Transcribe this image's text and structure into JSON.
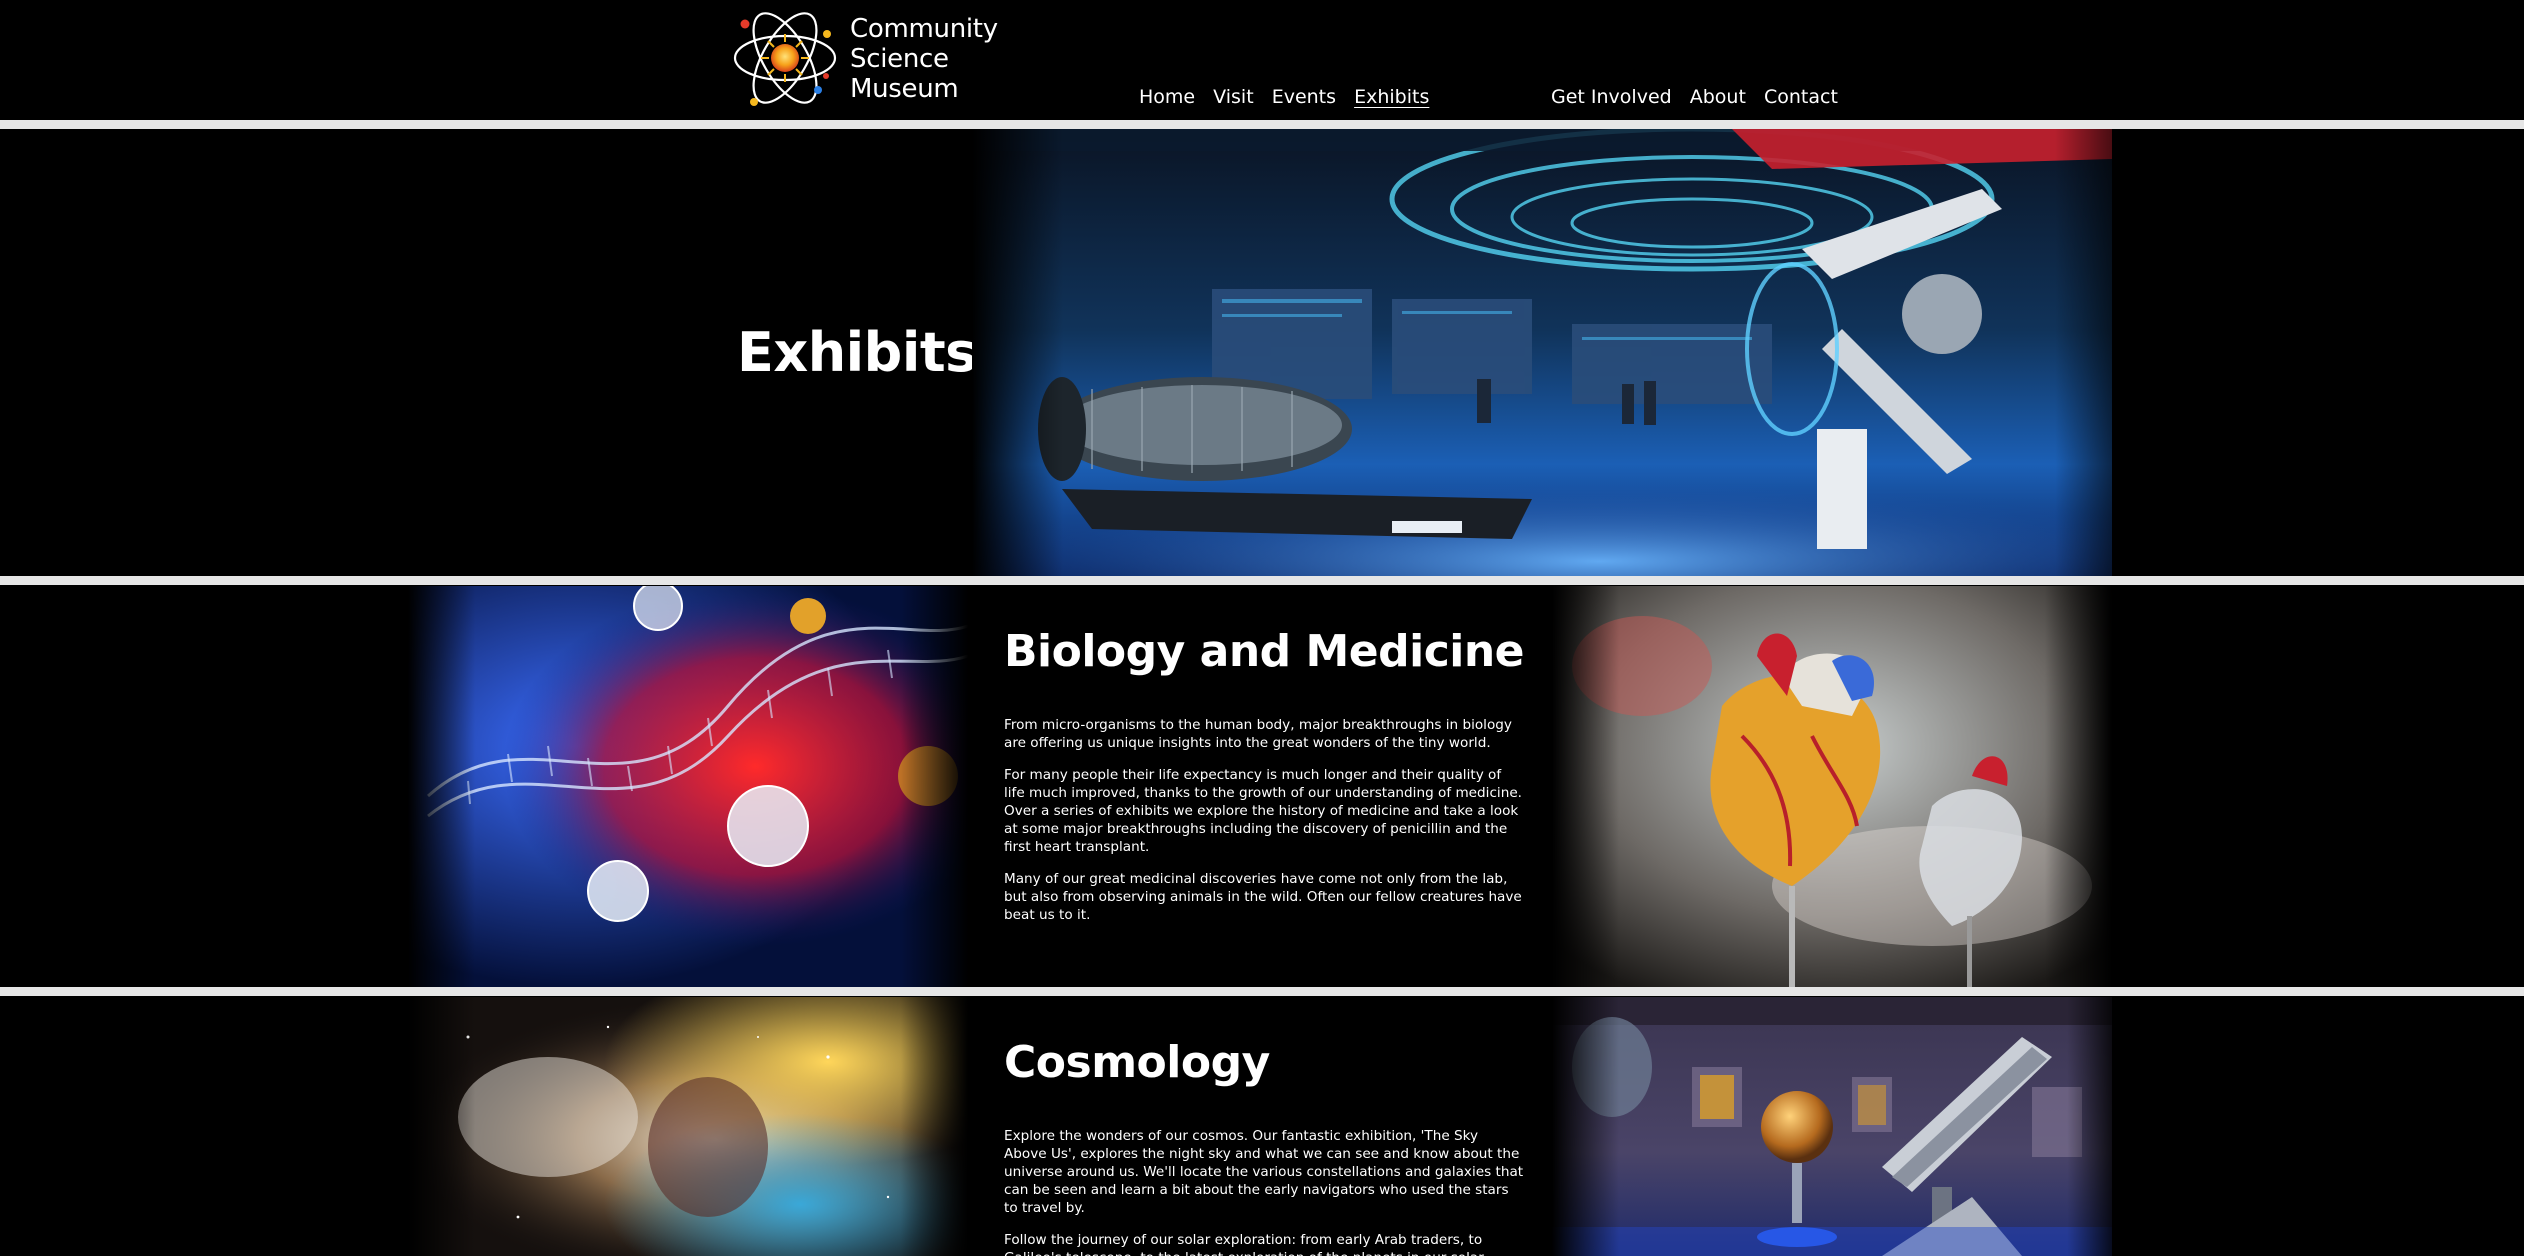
{
  "site": {
    "name_lines": [
      "Community",
      "Science",
      "Museum"
    ]
  },
  "nav": {
    "left": [
      {
        "label": "Home",
        "active": false
      },
      {
        "label": "Visit",
        "active": false
      },
      {
        "label": "Events",
        "active": false
      },
      {
        "label": "Exhibits",
        "active": true
      }
    ],
    "right": [
      {
        "label": "Get Involved"
      },
      {
        "label": "About"
      },
      {
        "label": "Contact"
      }
    ]
  },
  "hero": {
    "title": "Exhibits",
    "image": "exhibition-hall-photo"
  },
  "sections": {
    "biology": {
      "title": "Biology and Medicine",
      "paragraphs": [
        "From micro-organisms to the human body, major breakthroughs in biology are offering us unique insights into the great wonders of the tiny world.",
        "For many people their life expectancy is much longer and their quality of life much improved, thanks to the growth of our understanding of medicine. Over a series of exhibits we explore the history of medicine and take a look at some major breakthroughs including the discovery of penicillin and the first heart transplant.",
        "Many of our great medicinal discoveries have come not only from the lab, but also from observing animals in the wild. Often our fellow creatures have beat us to it."
      ],
      "left_image": "dna-virus-illustration",
      "right_image": "anatomical-heart-model-photo"
    },
    "cosmology": {
      "title": "Cosmology",
      "paragraphs": [
        "Explore the wonders of our cosmos. Our fantastic exhibition, 'The Sky Above Us', explores the night sky and what we can see and know about the universe around us. We'll locate the various constellations and galaxies that can be seen and learn a bit about the early navigators who used the stars to travel by.",
        "Follow the journey of our solar exploration: from early Arab traders, to Galileo's telescope, to the latest exploration of the planets in our solar system."
      ],
      "left_image": "nebula-image",
      "right_image": "telescope-gallery-photo"
    }
  },
  "colors": {
    "background": "#000000",
    "divider": "#e6e6e6",
    "text": "#ffffff"
  }
}
